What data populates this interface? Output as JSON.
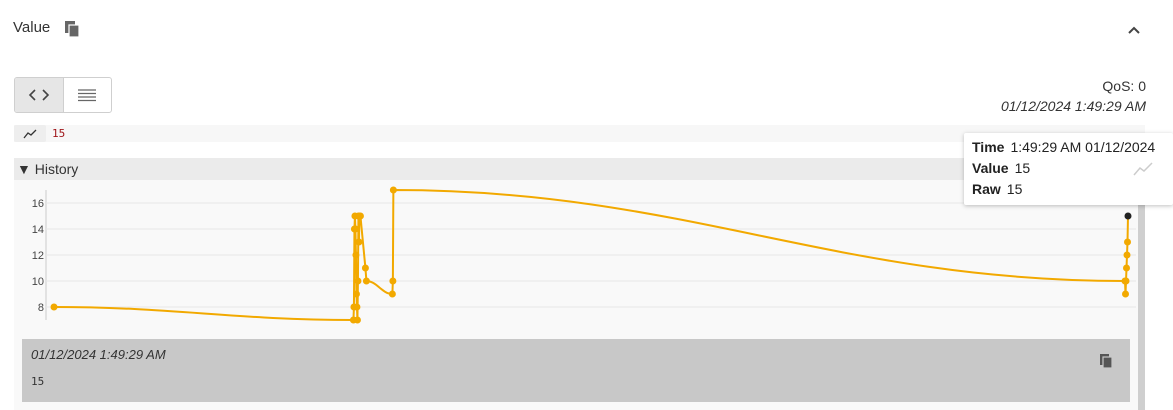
{
  "header": {
    "title": "Value"
  },
  "view_toggle": {
    "code_icon": "code-icon",
    "list_icon": "list-icon"
  },
  "meta": {
    "qos": "QoS: 0",
    "timestamp": "01/12/2024 1:49:29 AM"
  },
  "value": {
    "text": "15"
  },
  "history": {
    "label": "▼ History"
  },
  "tooltip": {
    "time_label": "Time",
    "time_value": "1:49:29 AM 01/12/2024",
    "value_label": "Value",
    "value_value": "15",
    "raw_label": "Raw",
    "raw_value": "15"
  },
  "detail": {
    "timestamp": "01/12/2024 1:49:29 AM",
    "value": "15"
  },
  "colors": {
    "line": "#f2a900",
    "point": "#f2a900",
    "selected_point": "#222222"
  },
  "chart_data": {
    "type": "line",
    "ylim": [
      7,
      17
    ],
    "yticks": [
      8,
      10,
      12,
      14,
      16
    ],
    "grid": true,
    "x": [
      0,
      300,
      300.5,
      301,
      301.5,
      302,
      302.5,
      303,
      303.5,
      304,
      304.5,
      305,
      305.5,
      306,
      307,
      312,
      313,
      339,
      339.5,
      340,
      1073,
      1073.5,
      1074,
      1074.5,
      1075,
      1075.5,
      1076
    ],
    "values": [
      8,
      7,
      8,
      14,
      15,
      14,
      12,
      9,
      8,
      7,
      10,
      15,
      13,
      15,
      15,
      11,
      10,
      9,
      10,
      17,
      10,
      9,
      10,
      11,
      12,
      13,
      15
    ]
  }
}
